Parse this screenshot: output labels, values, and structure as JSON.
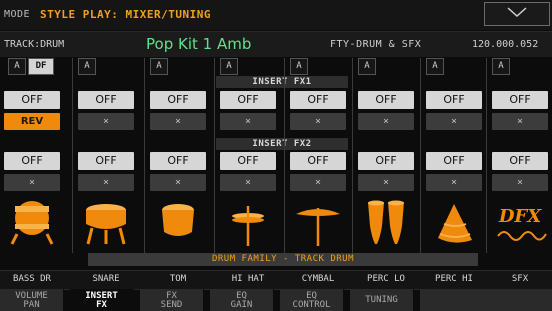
{
  "mode": {
    "label": "MODE",
    "title": "STYLE PLAY: MIXER/TUNING"
  },
  "track": {
    "label": "TRACK:DRUM",
    "kit_name": "Pop Kit 1 Amb",
    "bank": "FTY-DRUM & SFX",
    "number": "120.000.052"
  },
  "section_headers": {
    "insert_fx1": "INSERT FX1",
    "insert_fx2": "INSERT FX2"
  },
  "family_label": "DRUM FAMILY - TRACK DRUM",
  "channels": [
    {
      "a": "A",
      "df": "DF",
      "fx1": "OFF",
      "fx1_slot": "REV",
      "fx2": "OFF",
      "fx2_slot": "×",
      "name": "BASS DR",
      "icon": "bass-drum-icon"
    },
    {
      "a": "A",
      "fx1": "OFF",
      "fx1_slot": "×",
      "fx2": "OFF",
      "fx2_slot": "×",
      "name": "SNARE",
      "icon": "snare-drum-icon"
    },
    {
      "a": "A",
      "fx1": "OFF",
      "fx1_slot": "×",
      "fx2": "OFF",
      "fx2_slot": "×",
      "name": "TOM",
      "icon": "tom-icon"
    },
    {
      "a": "A",
      "fx1": "OFF",
      "fx1_slot": "×",
      "fx2": "OFF",
      "fx2_slot": "×",
      "name": "HI HAT",
      "icon": "hi-hat-icon"
    },
    {
      "a": "A",
      "fx1": "OFF",
      "fx1_slot": "×",
      "fx2": "OFF",
      "fx2_slot": "×",
      "name": "CYMBAL",
      "icon": "cymbal-icon"
    },
    {
      "a": "A",
      "fx1": "OFF",
      "fx1_slot": "×",
      "fx2": "OFF",
      "fx2_slot": "×",
      "name": "PERC LO",
      "icon": "conga-icon"
    },
    {
      "a": "A",
      "fx1": "OFF",
      "fx1_slot": "×",
      "fx2": "OFF",
      "fx2_slot": "×",
      "name": "PERC HI",
      "icon": "shaker-icon"
    },
    {
      "a": "A",
      "fx1": "OFF",
      "fx1_slot": "×",
      "fx2": "OFF",
      "fx2_slot": "×",
      "name": "SFX",
      "icon": "sfx-icon",
      "icon_text": "DFX"
    }
  ],
  "tabs": [
    {
      "line1": "VOLUME",
      "line2": "PAN",
      "active": false
    },
    {
      "line1": "INSERT",
      "line2": "FX",
      "active": true
    },
    {
      "line1": "FX",
      "line2": "SEND",
      "active": false
    },
    {
      "line1": "EQ",
      "line2": "GAIN",
      "active": false
    },
    {
      "line1": "EQ",
      "line2": "CONTROL",
      "active": false
    },
    {
      "line1": "TUNING",
      "line2": "",
      "active": false
    }
  ],
  "colors": {
    "accent": "#f08a0c",
    "title": "#f0a020",
    "kit_name": "#5fe38a",
    "icon": "#f08a0c"
  }
}
